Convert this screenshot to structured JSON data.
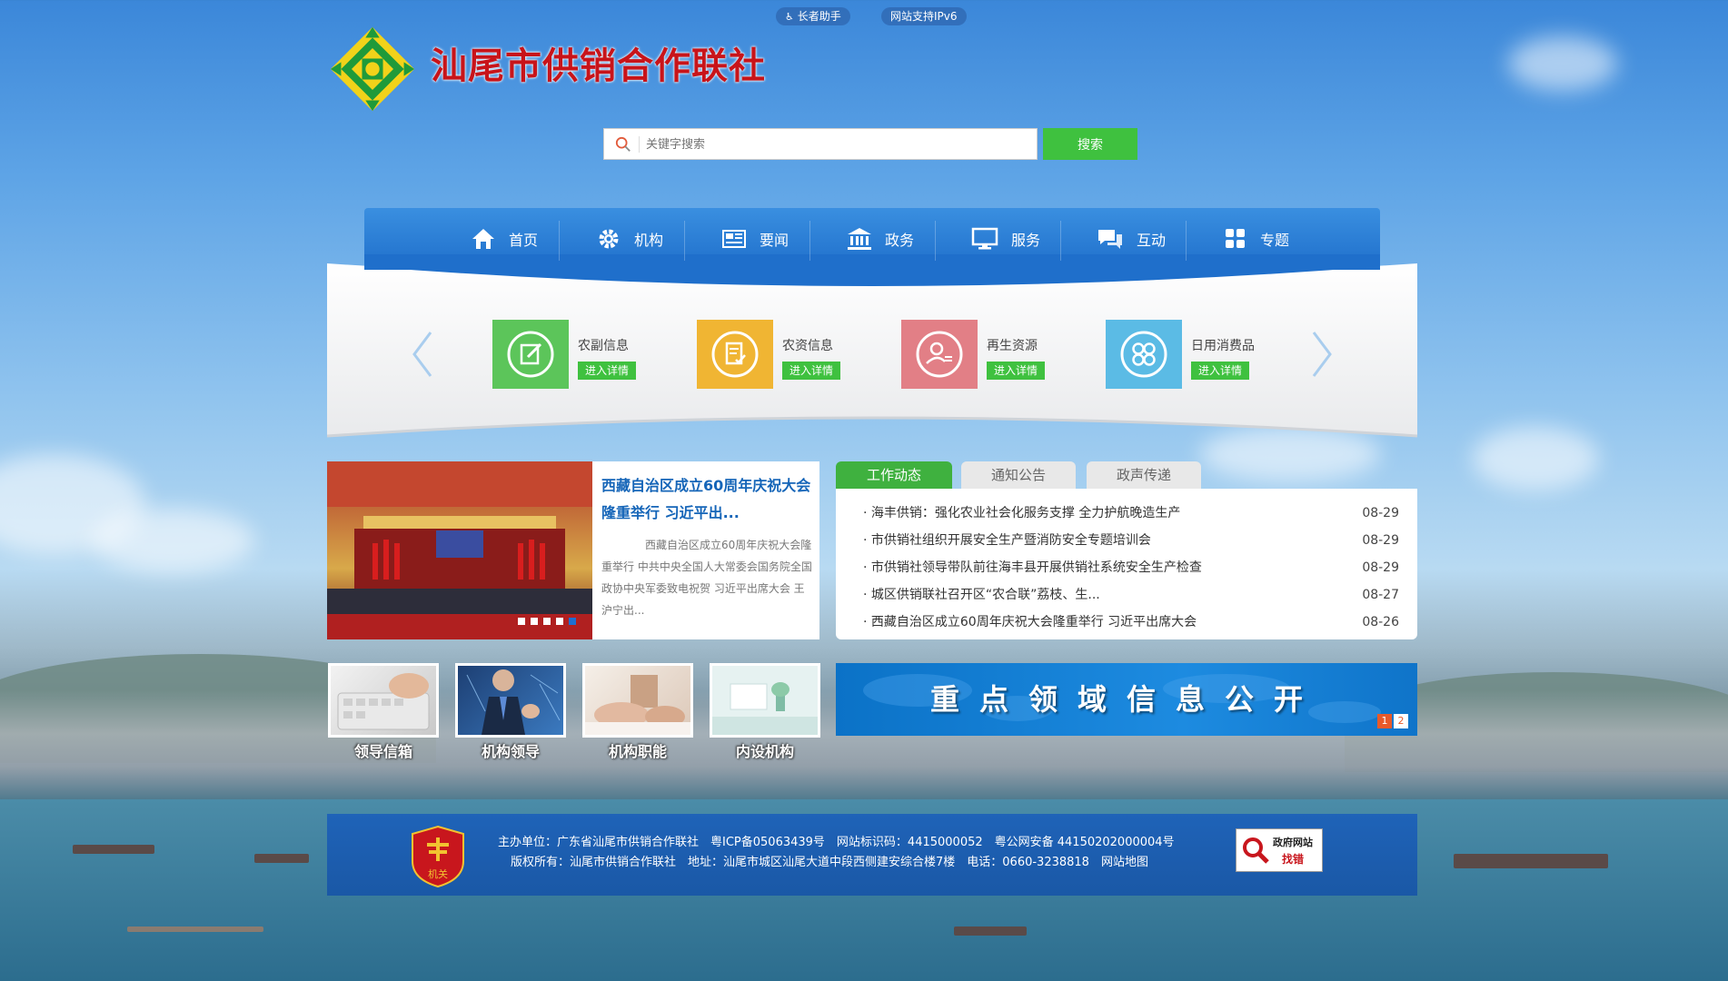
{
  "top_badges": {
    "elder_helper": "长者助手",
    "ipv6": "网站支持IPv6"
  },
  "site": {
    "title": "汕尾市供销合作联社"
  },
  "search": {
    "placeholder": "关键字搜索",
    "button": "搜索"
  },
  "nav": [
    {
      "label": "首页",
      "icon": "home-icon"
    },
    {
      "label": "机构",
      "icon": "gear-icon"
    },
    {
      "label": "要闻",
      "icon": "newspaper-icon"
    },
    {
      "label": "政务",
      "icon": "government-building-icon"
    },
    {
      "label": "服务",
      "icon": "monitor-icon"
    },
    {
      "label": "互动",
      "icon": "chat-icon"
    },
    {
      "label": "专题",
      "icon": "grid-icon"
    }
  ],
  "categories": [
    {
      "title": "农副信息",
      "button": "进入详情",
      "color": "#5cc55a",
      "icon": "edit-icon"
    },
    {
      "title": "农资信息",
      "button": "进入详情",
      "color": "#f0b533",
      "icon": "checklist-icon"
    },
    {
      "title": "再生资源",
      "button": "进入详情",
      "color": "#e27f86",
      "icon": "user-list-icon"
    },
    {
      "title": "日用消费品",
      "button": "进入详情",
      "color": "#5bbbe5",
      "icon": "clover-icon"
    }
  ],
  "feature": {
    "title": "西藏自治区成立60周年庆祝大会隆重举行 习近平出...",
    "description": "西藏自治区成立60周年庆祝大会隆重举行 中共中央全国人大常委会国务院全国政协中央军委致电祝贺 习近平出席大会 王沪宁出..."
  },
  "tabs": [
    "工作动态",
    "通知公告",
    "政声传递"
  ],
  "news": [
    {
      "title": "· 海丰供销：强化农业社会化服务支撑 全力护航晚造生产",
      "date": "08-29"
    },
    {
      "title": "· 市供销社组织开展安全生产暨消防安全专题培训会",
      "date": "08-29"
    },
    {
      "title": "· 市供销社领导带队前往海丰县开展供销社系统安全生产检查",
      "date": "08-29"
    },
    {
      "title": "· 城区供销联社召开区“农合联”荔枝、生...",
      "date": "08-27"
    },
    {
      "title": "· 西藏自治区成立60周年庆祝大会隆重举行 习近平出席大会",
      "date": "08-26"
    }
  ],
  "quick_links": [
    "领导信箱",
    "机构领导",
    "机构职能",
    "内设机构"
  ],
  "banner": {
    "text": "重点领域信息公开",
    "pages": [
      "1",
      "2"
    ]
  },
  "footer": {
    "line1": "主办单位：广东省汕尾市供销合作联社　粤ICP备05063439号　网站标识码：4415000052　粤公网安备 44150202000004号",
    "line2": "版权所有：汕尾市供销合作联社　地址：汕尾市城区汕尾大道中段西侧建安综合楼7楼　电话：0660-3238818　网站地图",
    "emblem_label": "机关",
    "gov_badge_line1": "政府网站",
    "gov_badge_line2": "找错"
  }
}
